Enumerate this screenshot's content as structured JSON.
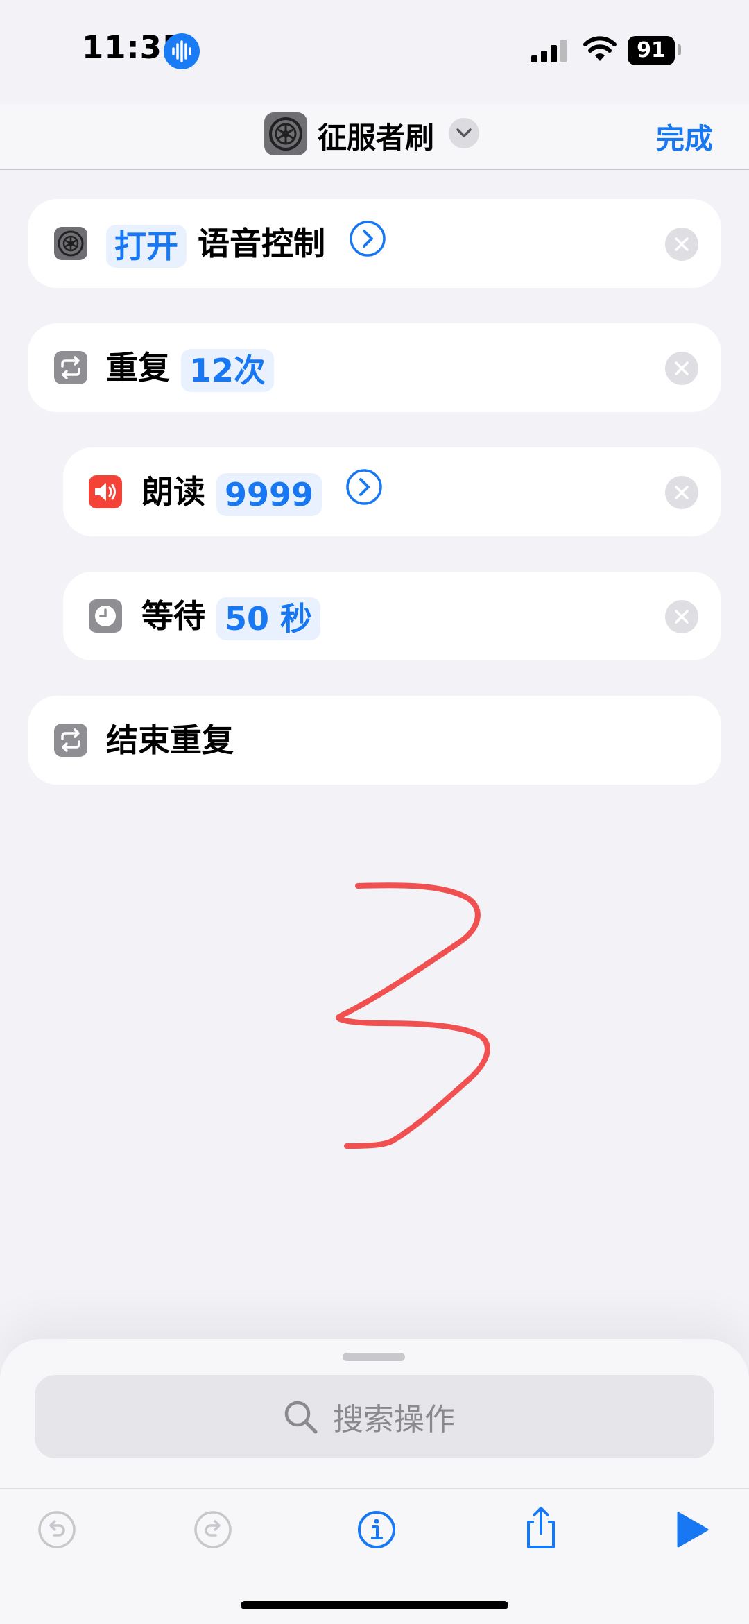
{
  "status_bar": {
    "time": "11:35",
    "battery": "91",
    "icons": [
      "voice-memo-icon",
      "cellular-signal-icon",
      "wifi-icon",
      "battery-icon"
    ]
  },
  "nav": {
    "title": "征服者刷",
    "done_label": "完成",
    "app_icon": "settings-gear-icon"
  },
  "actions": [
    {
      "icon": "settings-gear-icon",
      "verb": "打开",
      "value": "语音控制",
      "has_arrow": true
    },
    {
      "icon": "repeat-icon",
      "verb": "重复",
      "value": "12次"
    },
    {
      "icon": "speaker-icon",
      "verb": "朗读",
      "value": "9999",
      "has_arrow": true
    },
    {
      "icon": "clock-icon",
      "verb": "等待",
      "value": "50 秒"
    },
    {
      "icon": "repeat-icon",
      "verb": "结束重复"
    }
  ],
  "search": {
    "placeholder": "搜索操作"
  },
  "toolbar": {
    "buttons": [
      "undo-icon",
      "redo-icon",
      "info-icon",
      "share-icon",
      "play-icon"
    ]
  },
  "colors": {
    "accent": "#1877f2",
    "background": "#f2f2f7",
    "doodle": "#f05050"
  }
}
